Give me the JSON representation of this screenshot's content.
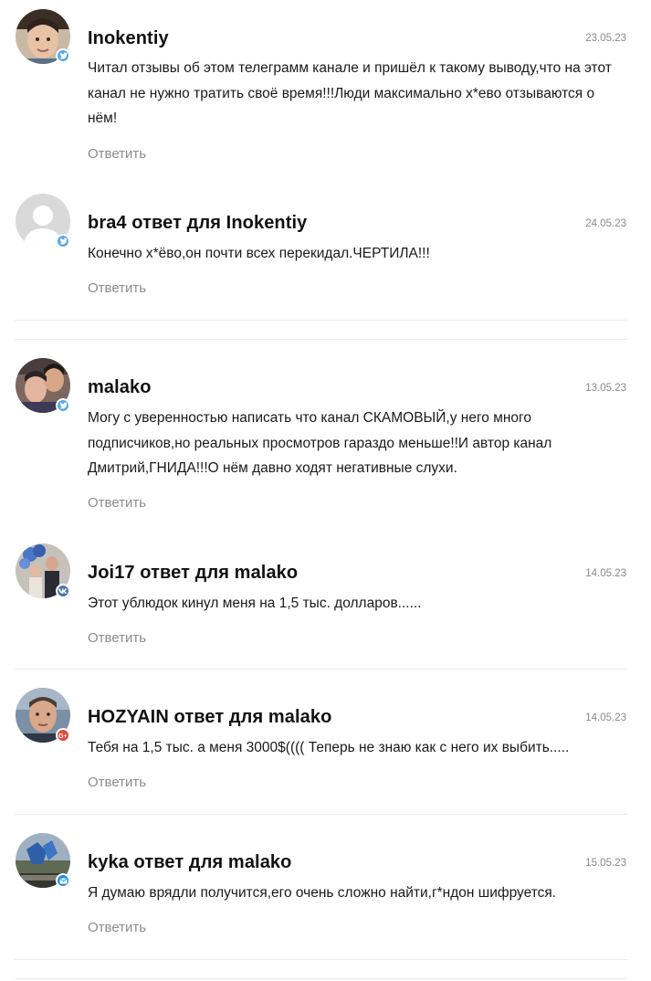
{
  "comments": [
    {
      "author": "Inokentiy",
      "date": "23.05.23",
      "text": "Читал отзывы об этом телеграмм канале и пришёл к такому выводу,что на этот канал не нужно тратить своё время!!!Люди максимально х*ево отзываются о нём!",
      "reply": "Ответить",
      "badge": "twitter-icon"
    },
    {
      "author": "bra4 ответ для Inokentiy",
      "date": "24.05.23",
      "text": "Конечно х*ёво,он почти всех перекидал.ЧЕРТИЛА!!!",
      "reply": "Ответить",
      "badge": "twitter-icon"
    },
    {
      "author": "malako",
      "date": "13.05.23",
      "text": "Могу с уверенностью написать что канал СКАМОВЫЙ,у него много подписчиков,но реальных просмотров гараздо меньше!!И автор канал Дмитрий,ГНИДА!!!О нём давно ходят негативные слухи.",
      "reply": "Ответить",
      "badge": "twitter-icon"
    },
    {
      "author": "Joi17 ответ для malako",
      "date": "14.05.23",
      "text": "Этот ублюдок кинул меня на 1,5 тыс. долларов......",
      "reply": "Ответить",
      "badge": "vk-icon"
    },
    {
      "author": "HOZYAIN ответ для malako",
      "date": "14.05.23",
      "text": "Тебя на 1,5 тыс. а меня 3000$(((( Теперь не знаю как с него их выбить.....",
      "reply": "Ответить",
      "badge": "google-plus-icon"
    },
    {
      "author": "kyka ответ для malako",
      "date": "15.05.23",
      "text": "Я думаю врядли получится,его очень сложно найти,г*ндон шифруется.",
      "reply": "Ответить",
      "badge": "mail-icon"
    }
  ],
  "colors": {
    "twitter": "#5aa9e6",
    "vk": "#4a76a8",
    "google_plus": "#dd4b39",
    "mail": "#168de2"
  }
}
